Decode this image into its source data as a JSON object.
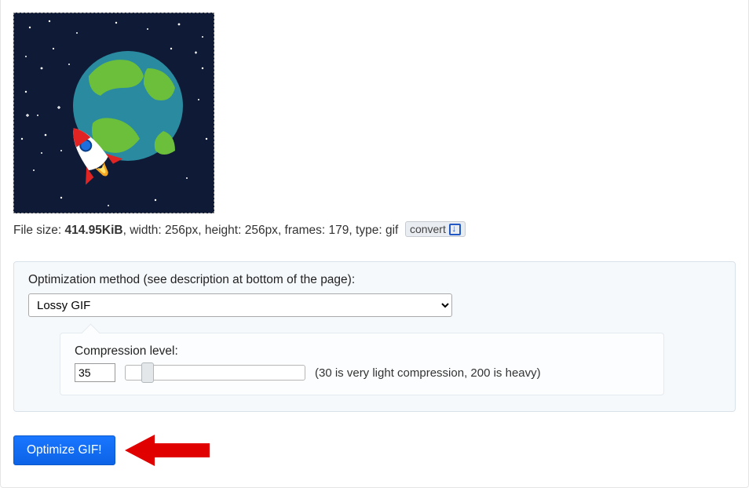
{
  "file_info": {
    "size_label": "File size: ",
    "size_value": "414.95KiB",
    "width_label": ", width: ",
    "width_value": "256px",
    "height_label": ", height: ",
    "height_value": "256px",
    "frames_label": ", frames: ",
    "frames_value": "179",
    "type_label": ", type: ",
    "type_value": "gif"
  },
  "convert_label": "convert",
  "options": {
    "method_label": "Optimization method (see description at bottom of the page):",
    "method_value": "Lossy GIF",
    "compression_label": "Compression level:",
    "compression_value": "35",
    "compression_hint": "(30 is very light compression, 200 is heavy)"
  },
  "action": {
    "optimize_label": "Optimize GIF!"
  }
}
